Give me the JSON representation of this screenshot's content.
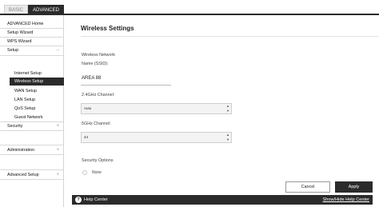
{
  "tabs": {
    "basic": "BASIC",
    "advanced": "ADVANCED"
  },
  "sidebar": {
    "advanced_home": "ADVANCED Home",
    "setup_wizard": "Setup Wizard",
    "wps_wizard": "WPS Wizard",
    "setup": "Setup",
    "setup_items": [
      "Internet Setup",
      "Wireless Setup",
      "WAN Setup",
      "LAN Setup",
      "QoS Setup",
      "Guest Network"
    ],
    "security": "Security",
    "administration": "Administration",
    "advanced_setup": "Advanced Setup",
    "expander": "+",
    "collapse": "–"
  },
  "main": {
    "title": "Wireless Settings",
    "wireless_network_label": "Wireless Network",
    "ssid_label": "Name (SSID):",
    "ssid_value": "AREA 88",
    "ch24_label": "2.4GHz Channel:",
    "ch24_value": "Auto",
    "ch5_label": "5GHz Channel:",
    "ch5_value": "44",
    "security_label": "Security Options",
    "security_option_none": "None"
  },
  "buttons": {
    "cancel": "Cancel",
    "apply": "Apply"
  },
  "helpbar": {
    "icon": "?",
    "label": "Help Center",
    "toggle": "Show/Hide Help Center"
  }
}
